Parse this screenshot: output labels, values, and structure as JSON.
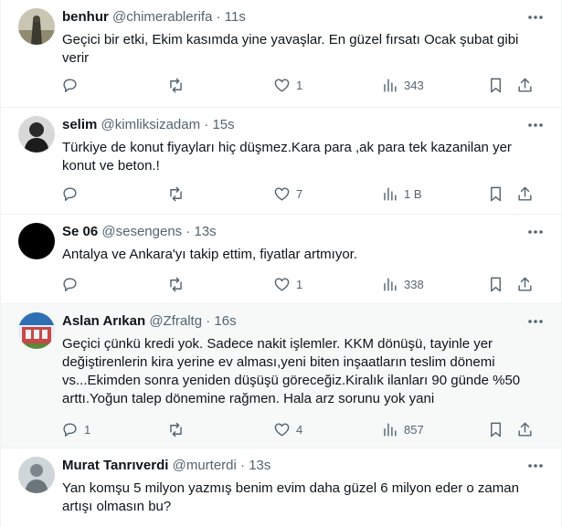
{
  "tweets": [
    {
      "name": "benhur",
      "handle": "@chimerablerifa",
      "time": "11s",
      "text": "Geçici bir etki, Ekim kasımda yine yavaşlar. En güzel fırsatı Ocak şubat gibi verir",
      "replies": "",
      "retweets": "",
      "likes": "1",
      "views": "343",
      "avatar_color": "#6b6a5a"
    },
    {
      "name": "selim",
      "handle": "@kimliksizadam",
      "time": "15s",
      "text": "Türkiye de konut fiyayları hiç düşmez.Kara para ,ak para tek kazanilan yer konut ve beton.!",
      "replies": "",
      "retweets": "",
      "likes": "7",
      "views": "1 B",
      "avatar_color": "#3a3a3a"
    },
    {
      "name": "Se 06",
      "handle": "@sesengens",
      "time": "13s",
      "text": "Antalya ve Ankara'yı takip ettim, fiyatlar artmıyor.",
      "replies": "",
      "retweets": "",
      "likes": "1",
      "views": "338",
      "avatar_color": "#000000"
    },
    {
      "name": "Aslan Arıkan",
      "handle": "@Zfraltg",
      "time": "16s",
      "text": "Geçici çünkü kredi yok. Sadece nakit işlemler. KKM dönüşü, tayinle yer değiştirenlerin kira yerine ev alması,yeni biten inşaatların teslim dönemi vs...Ekimden sonra yeniden düşüşü göreceğiz.Kiralık ilanları 90 günde %50 arttı.Yoğun talep dönemine rağmen. Hala arz sorunu yok yani",
      "replies": "1",
      "retweets": "",
      "likes": "4",
      "views": "857",
      "avatar_color": "#2f6fb3"
    },
    {
      "name": "Murat Tanrıverdi",
      "handle": "@murterdi",
      "time": "13s",
      "text": "Yan komşu 5 milyon yazmış benim evim daha güzel 6 milyon eder o zaman artışı olmasın bu?",
      "replies": "",
      "retweets": "",
      "likes": "",
      "views": "",
      "avatar_color": "#9aa3a8"
    }
  ],
  "separator": "·"
}
